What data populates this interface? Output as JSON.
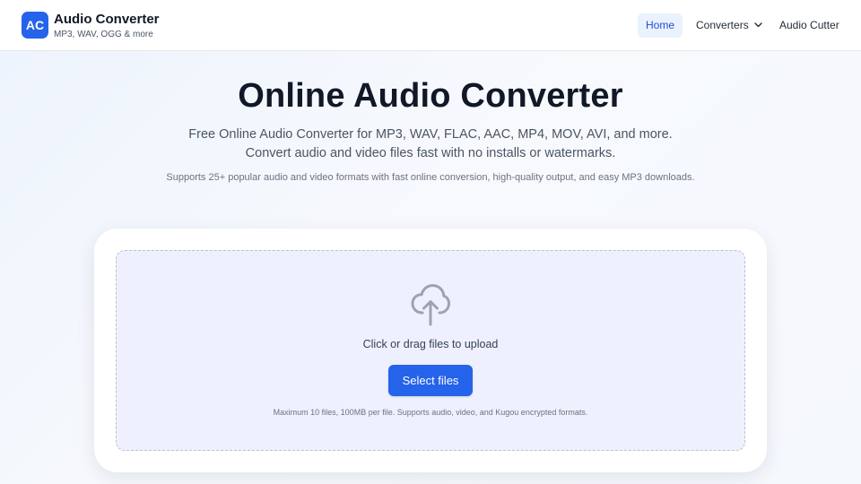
{
  "brand": {
    "logo": "AC",
    "name": "Audio Converter",
    "tagline": "MP3, WAV, OGG & more"
  },
  "nav": {
    "items": [
      {
        "label": "Home",
        "active": true
      },
      {
        "label": "Converters",
        "dropdown": true
      },
      {
        "label": "Audio Cutter"
      }
    ]
  },
  "hero": {
    "title": "Online Audio Converter",
    "description": "Free Online Audio Converter for MP3, WAV, FLAC, AAC, MP4, MOV, AVI, and more. Convert audio and video files fast with no installs or watermarks.",
    "subtitle": "Supports 25+ popular audio and video formats with fast online conversion, high-quality output, and easy MP3 downloads."
  },
  "upload": {
    "icon": "cloud-upload-icon",
    "prompt": "Click or drag files to upload",
    "button_label": "Select files",
    "limits": "Maximum 10 files, 100MB per file. Supports audio, video, and Kugou encrypted formats."
  },
  "colors": {
    "accent": "#2563eb",
    "nav_active_bg": "#eaf2fd",
    "dropzone_bg": "#eef1fd"
  }
}
